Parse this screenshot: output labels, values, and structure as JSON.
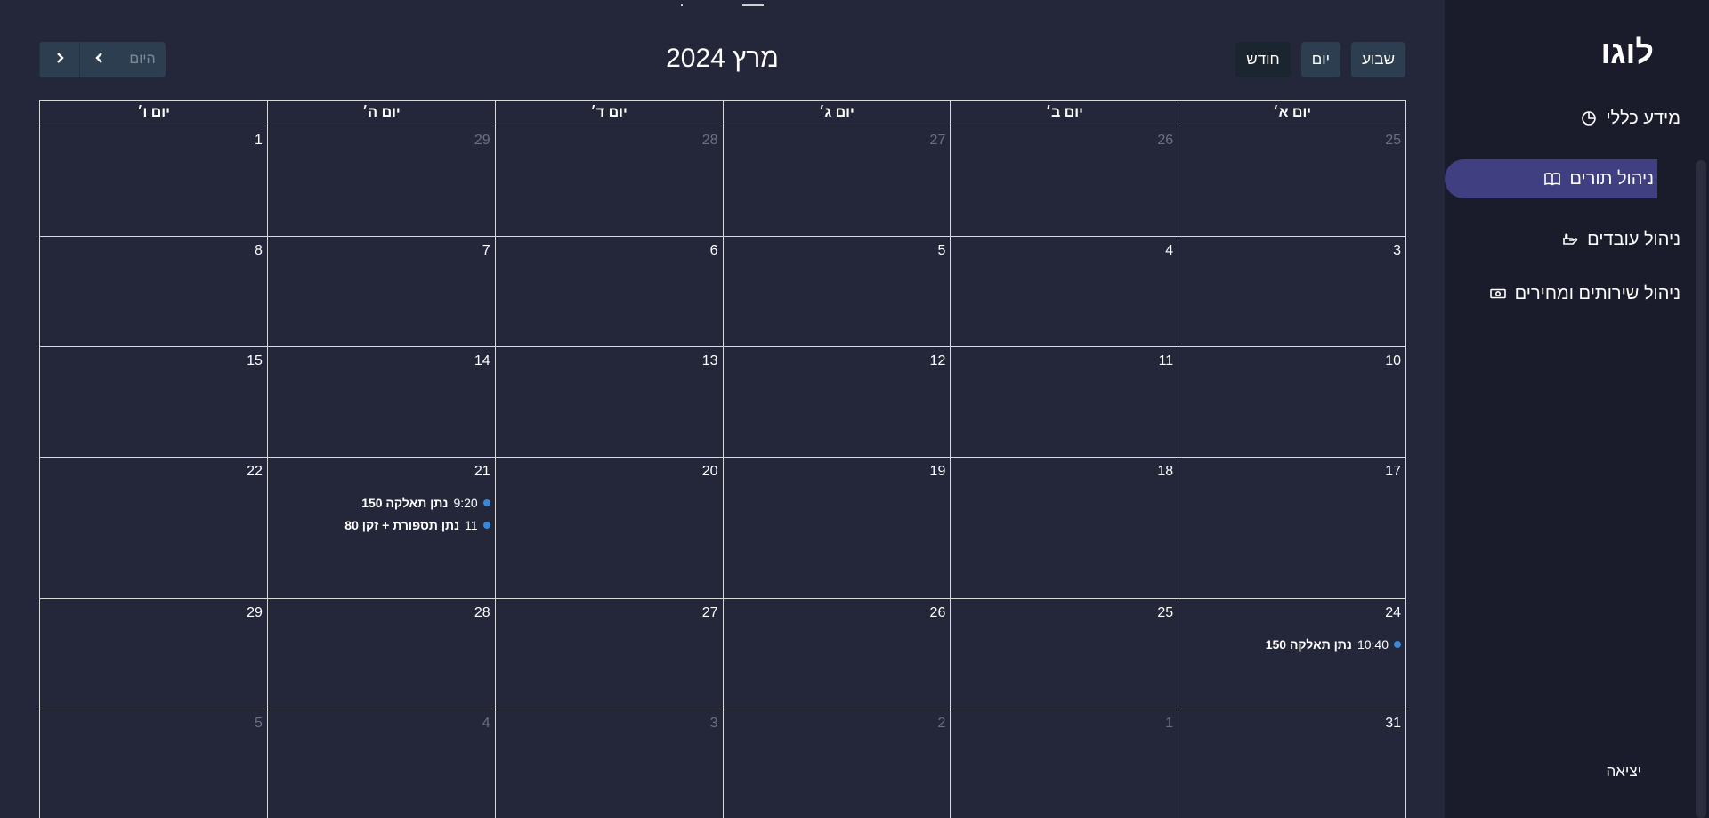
{
  "sidebar": {
    "logo": "לוגו",
    "items": [
      {
        "label": "מידע כללי",
        "icon": "pie-chart-icon"
      },
      {
        "label": "ניהול תורים",
        "icon": "book-icon",
        "active": true
      },
      {
        "label": "ניהול עובדים",
        "icon": "hand-icon"
      },
      {
        "label": "ניהול שירותים ומחירים",
        "icon": "money-icon"
      }
    ],
    "logout": "יציאה"
  },
  "toolbar": {
    "title": "מרץ 2024",
    "today_label": "היום",
    "views": [
      {
        "label": "שבוע"
      },
      {
        "label": "יום"
      },
      {
        "label": "חודש",
        "active": true
      }
    ]
  },
  "calendar": {
    "headers": [
      "יום א׳",
      "יום ב׳",
      "יום ג׳",
      "יום ד׳",
      "יום ה׳",
      "יום ו׳"
    ],
    "event_color": "#3788d8",
    "weeks": [
      {
        "days": [
          {
            "n": "25",
            "other": true
          },
          {
            "n": "26",
            "other": true
          },
          {
            "n": "27",
            "other": true
          },
          {
            "n": "28",
            "other": true
          },
          {
            "n": "29",
            "other": true
          },
          {
            "n": "1"
          }
        ]
      },
      {
        "days": [
          {
            "n": "3"
          },
          {
            "n": "4"
          },
          {
            "n": "5"
          },
          {
            "n": "6"
          },
          {
            "n": "7"
          },
          {
            "n": "8"
          }
        ]
      },
      {
        "days": [
          {
            "n": "10"
          },
          {
            "n": "11"
          },
          {
            "n": "12"
          },
          {
            "n": "13"
          },
          {
            "n": "14"
          },
          {
            "n": "15"
          }
        ]
      },
      {
        "days": [
          {
            "n": "17"
          },
          {
            "n": "18"
          },
          {
            "n": "19"
          },
          {
            "n": "20"
          },
          {
            "n": "21",
            "events": [
              {
                "time": "9:20",
                "title": "נתן תאלקה 150"
              },
              {
                "time": "11",
                "title": "נתן תספורת + זקן 80"
              }
            ]
          },
          {
            "n": "22"
          }
        ]
      },
      {
        "days": [
          {
            "n": "24",
            "events": [
              {
                "time": "10:40",
                "title": "נתן תאלקה 150"
              }
            ]
          },
          {
            "n": "25"
          },
          {
            "n": "26"
          },
          {
            "n": "27"
          },
          {
            "n": "28"
          },
          {
            "n": "29"
          }
        ]
      },
      {
        "days": [
          {
            "n": "31"
          },
          {
            "n": "1",
            "other": true
          },
          {
            "n": "2",
            "other": true
          },
          {
            "n": "3",
            "other": true
          },
          {
            "n": "4",
            "other": true
          },
          {
            "n": "5",
            "other": true
          }
        ]
      }
    ]
  }
}
